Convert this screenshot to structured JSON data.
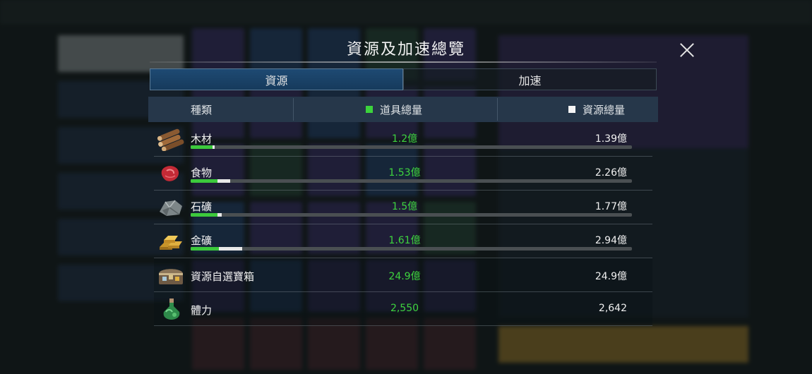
{
  "modal": {
    "title": "資源及加速總覽",
    "tabs": [
      {
        "label": "資源",
        "active": true
      },
      {
        "label": "加速",
        "active": false
      }
    ],
    "header": {
      "category": "種類",
      "items_total": "道具總量",
      "resource_total": "資源總量"
    },
    "rows": [
      {
        "name": "木材",
        "icon": "wood-log-icon",
        "items": "1.2億",
        "resources": "1.39億",
        "items_fraction": 0.05,
        "resources_fraction": 0.055
      },
      {
        "name": "食物",
        "icon": "meat-icon",
        "items": "1.53億",
        "resources": "2.26億",
        "items_fraction": 0.06,
        "resources_fraction": 0.09
      },
      {
        "name": "石礦",
        "icon": "stone-icon",
        "items": "1.5億",
        "resources": "1.77億",
        "items_fraction": 0.06,
        "resources_fraction": 0.07
      },
      {
        "name": "金礦",
        "icon": "gold-bar-icon",
        "items": "1.61億",
        "resources": "2.94億",
        "items_fraction": 0.064,
        "resources_fraction": 0.117
      },
      {
        "name": "資源自選寶箱",
        "icon": "treasure-chest-icon",
        "items": "24.9億",
        "resources": "24.9億"
      },
      {
        "name": "體力",
        "icon": "stamina-potion-icon",
        "items": "2,550",
        "resources": "2,642"
      }
    ]
  },
  "colors": {
    "items_green": "#3cd33c",
    "resource_white": "#f5f5f5",
    "active_tab": "#1e4a73",
    "header_bg": "#26374a"
  }
}
